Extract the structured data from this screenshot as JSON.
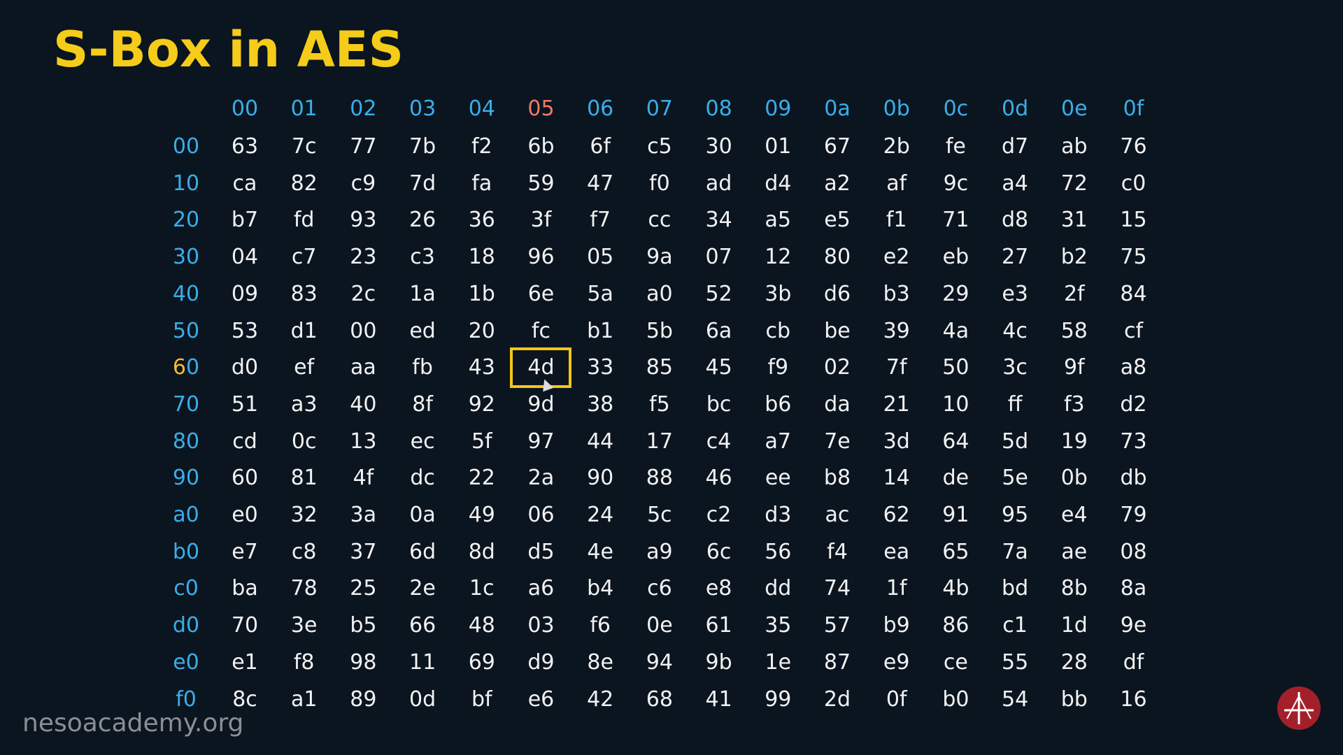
{
  "title": "S-Box in AES",
  "column_headers": [
    "00",
    "01",
    "02",
    "03",
    "04",
    "05",
    "06",
    "07",
    "08",
    "09",
    "0a",
    "0b",
    "0c",
    "0d",
    "0e",
    "0f"
  ],
  "row_headers": [
    "00",
    "10",
    "20",
    "30",
    "40",
    "50",
    "60",
    "70",
    "80",
    "90",
    "a0",
    "b0",
    "c0",
    "d0",
    "e0",
    "f0"
  ],
  "rows": [
    [
      "63",
      "7c",
      "77",
      "7b",
      "f2",
      "6b",
      "6f",
      "c5",
      "30",
      "01",
      "67",
      "2b",
      "fe",
      "d7",
      "ab",
      "76"
    ],
    [
      "ca",
      "82",
      "c9",
      "7d",
      "fa",
      "59",
      "47",
      "f0",
      "ad",
      "d4",
      "a2",
      "af",
      "9c",
      "a4",
      "72",
      "c0"
    ],
    [
      "b7",
      "fd",
      "93",
      "26",
      "36",
      "3f",
      "f7",
      "cc",
      "34",
      "a5",
      "e5",
      "f1",
      "71",
      "d8",
      "31",
      "15"
    ],
    [
      "04",
      "c7",
      "23",
      "c3",
      "18",
      "96",
      "05",
      "9a",
      "07",
      "12",
      "80",
      "e2",
      "eb",
      "27",
      "b2",
      "75"
    ],
    [
      "09",
      "83",
      "2c",
      "1a",
      "1b",
      "6e",
      "5a",
      "a0",
      "52",
      "3b",
      "d6",
      "b3",
      "29",
      "e3",
      "2f",
      "84"
    ],
    [
      "53",
      "d1",
      "00",
      "ed",
      "20",
      "fc",
      "b1",
      "5b",
      "6a",
      "cb",
      "be",
      "39",
      "4a",
      "4c",
      "58",
      "cf"
    ],
    [
      "d0",
      "ef",
      "aa",
      "fb",
      "43",
      "4d",
      "33",
      "85",
      "45",
      "f9",
      "02",
      "7f",
      "50",
      "3c",
      "9f",
      "a8"
    ],
    [
      "51",
      "a3",
      "40",
      "8f",
      "92",
      "9d",
      "38",
      "f5",
      "bc",
      "b6",
      "da",
      "21",
      "10",
      "ff",
      "f3",
      "d2"
    ],
    [
      "cd",
      "0c",
      "13",
      "ec",
      "5f",
      "97",
      "44",
      "17",
      "c4",
      "a7",
      "7e",
      "3d",
      "64",
      "5d",
      "19",
      "73"
    ],
    [
      "60",
      "81",
      "4f",
      "dc",
      "22",
      "2a",
      "90",
      "88",
      "46",
      "ee",
      "b8",
      "14",
      "de",
      "5e",
      "0b",
      "db"
    ],
    [
      "e0",
      "32",
      "3a",
      "0a",
      "49",
      "06",
      "24",
      "5c",
      "c2",
      "d3",
      "ac",
      "62",
      "91",
      "95",
      "e4",
      "79"
    ],
    [
      "e7",
      "c8",
      "37",
      "6d",
      "8d",
      "d5",
      "4e",
      "a9",
      "6c",
      "56",
      "f4",
      "ea",
      "65",
      "7a",
      "ae",
      "08"
    ],
    [
      "ba",
      "78",
      "25",
      "2e",
      "1c",
      "a6",
      "b4",
      "c6",
      "e8",
      "dd",
      "74",
      "1f",
      "4b",
      "bd",
      "8b",
      "8a"
    ],
    [
      "70",
      "3e",
      "b5",
      "66",
      "48",
      "03",
      "f6",
      "0e",
      "61",
      "35",
      "57",
      "b9",
      "86",
      "c1",
      "1d",
      "9e"
    ],
    [
      "e1",
      "f8",
      "98",
      "11",
      "69",
      "d9",
      "8e",
      "94",
      "9b",
      "1e",
      "87",
      "e9",
      "ce",
      "55",
      "28",
      "df"
    ],
    [
      "8c",
      "a1",
      "89",
      "0d",
      "bf",
      "e6",
      "42",
      "68",
      "41",
      "99",
      "2d",
      "0f",
      "b0",
      "54",
      "bb",
      "16"
    ]
  ],
  "highlight": {
    "row_index": 6,
    "col_index": 5
  },
  "colors": {
    "title": "#f5cc1a",
    "header": "#3aaee8",
    "cell": "#f2f2f2",
    "highlight_box": "#f5c518",
    "background": "#0b1520"
  },
  "footer": "nesoacademy.org",
  "logo_icon": "neso-logo-icon"
}
